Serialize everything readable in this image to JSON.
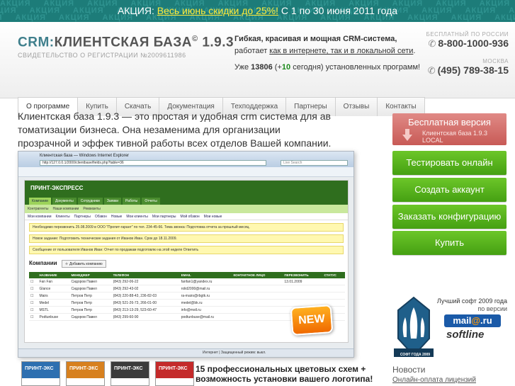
{
  "promo": {
    "background_word": "АКЦИЯ",
    "prefix": "АКЦИЯ: ",
    "link": "Весь июнь скидки до 25%!",
    "suffix": " С 1 по 30 июня 2011 года"
  },
  "header": {
    "title_crm": "CRM:",
    "title_main": "КЛИЕНТСКАЯ БАЗА",
    "title_sup": "©",
    "title_version": " 1.9.3",
    "subtitle": "СВИДЕТЕЛЬСТВО О РЕГИСТРАЦИИ №2009611986",
    "tagline_line1": "Гибкая, красивая и мощная CRM-система,",
    "tagline_line2_prefix": "работает ",
    "tagline_link": "как в интернете, так и в локальной сети",
    "tagline_line2_suffix": ".",
    "installs_prefix": "Уже ",
    "installs_total": "13806",
    "installs_mid": " (+",
    "installs_today": "10",
    "installs_suffix": " сегодня) установленных программ!"
  },
  "phones": {
    "free_caption": "БЕСПЛАТНЫЙ ПО РОССИИ",
    "free_number": "8-800-1000-936",
    "moscow_caption": "МОСКВА",
    "moscow_number": "(495) 789-38-15"
  },
  "nav": {
    "tabs": [
      "О программе",
      "Купить",
      "Скачать",
      "Документация",
      "Техподдержка",
      "Партнеры",
      "Отзывы",
      "Контакты"
    ],
    "active": "О программе"
  },
  "main": {
    "description": "Клиентская база 1.9.3 — это простая и удобная crm система для ав томатизации бизнеса. Она незаменима для организации прозрачной и эффек тивной работы всех отделов Вашей компании.",
    "new_badge": "NEW",
    "themes_text_line1": "15 профессиональных цветовых схем +",
    "themes_text_line2": "возможность установки вашего логотипа!",
    "themes": [
      {
        "label": "ПРИНТ-ЭКС",
        "color": "#2d6fb0"
      },
      {
        "label": "ПРИНТ-ЭКС",
        "color": "#d7801e"
      },
      {
        "label": "ПРИНТ-ЭКС",
        "color": "#3b3b3b"
      },
      {
        "label": "ПРИНТ-ЭКС",
        "color": "#c42a2a"
      }
    ]
  },
  "screenshot": {
    "window_title": "Клиентская база — Windows Internet Explorer",
    "address": "http://127.0.0.1/2000/clientbase/fields.php?table=36",
    "search_placeholder": "Live Search",
    "app_name": "ПРИНТ-ЭКСПРЕСС",
    "app_tabs": [
      "Компании",
      "Документы",
      "Сотрудники",
      "Заявки",
      "Работы",
      "Отчеты"
    ],
    "app_subtabs": [
      "Контрагенты",
      "Наши компании",
      "Реквизиты"
    ],
    "app_menu": [
      "Мои компании",
      "Клиенты",
      "Партнеры",
      "Обзвон",
      "Новые",
      "Мои клиенты",
      "Мои партнеры",
      "Мой обзвон",
      "Мои новые"
    ],
    "notices": [
      "Необходимо перезвонить 25.08.2009 в ООО \"Пропит-гарант\" по тел. 234-45-66. Тема звонка: Подготовка отчета за прошлый месяц.",
      "Новое задание: Подготовить технические задания от Иванов Иван. Срок до 18.11.2009.",
      "Сообщение от пользователя Иванов Иван: Отчет по продажам подготовлю на этой неделе Ответить"
    ],
    "companies_title": "Компании",
    "add_company": "Добавить компанию",
    "columns": [
      "НАЗВАНИЕ",
      "МЕНЕДЖЕР",
      "ТЕЛЕФОН",
      "EMAIL",
      "КОНТАКТНОЕ ЛИЦО",
      "ПЕРЕЗВОНИТЬ",
      "СТАТУС"
    ],
    "rows": [
      [
        "Fan Fan",
        "Сидоров Павел",
        "(843) 292-06-22",
        "fanfan1@yandex.ru",
        "",
        "13.01.2009",
        ""
      ],
      [
        "Glance",
        "Сидоров Павел",
        "(843) 292-43-02",
        "rolid2000@mail.ru",
        "",
        "",
        ""
      ],
      [
        "Mairs",
        "Петров Петр",
        "(843) 220-88-43, 236-82-03",
        "ra-mairs@rbgtk.ru",
        "",
        "",
        ""
      ],
      [
        "Medel",
        "Петров Петр",
        "(843) 521-26-73, 266-01-00",
        "medel@bk.ru",
        "",
        "",
        ""
      ],
      [
        "MSTL",
        "Петров Петр",
        "(843) 213-13-29, 523-60-47",
        "info@mstl.ru",
        "",
        "",
        ""
      ],
      [
        "Podtunbuse",
        "Сидоров Павел",
        "(843) 299-60-90",
        "podtunbuse@mail.ru",
        "",
        "",
        ""
      ]
    ],
    "status_text": "Интернет | Защищенный режим: выкл."
  },
  "sidebar": {
    "free_version_title": "Бесплатная версия",
    "free_version_sub1": "Клиентская база 1.9.3",
    "free_version_sub2": "LOCAL",
    "buttons": [
      "Тестировать онлайн",
      "Создать аккаунт",
      "Заказать конфигурацию",
      "Купить"
    ],
    "award_caption": "СОФТ ГОДА 2009",
    "best_line1": "Лучший софт 2009 года",
    "best_line2": "по версии",
    "mailru_main": "mail",
    "mailru_at": "@",
    "mailru_tld": ".ru",
    "softline": "softline",
    "news_title": "Новости",
    "news_item": "Онлайн-оплата лицензий"
  },
  "colors": {
    "promo_bg": "#1d7c79",
    "promo_link": "#ffeb3b",
    "green_button": "#55b01a",
    "red_button": "#d26f6b",
    "app_green": "#2f6e1e"
  }
}
